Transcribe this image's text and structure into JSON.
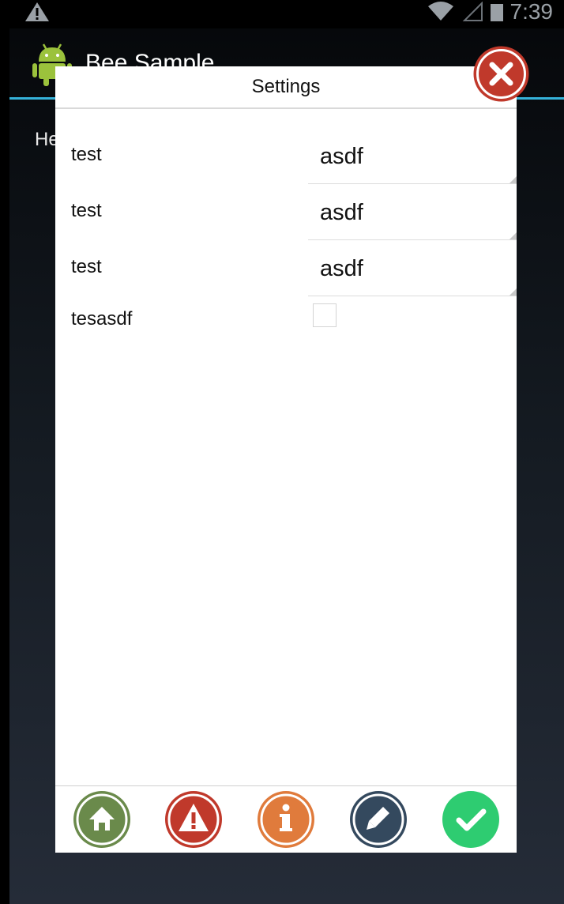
{
  "status_bar": {
    "time": "7:39",
    "icons": [
      "warning-icon",
      "wifi-icon",
      "signal-icon",
      "battery-icon"
    ]
  },
  "action_bar": {
    "title": "Bee Sample",
    "icon": "android-icon",
    "accent_color": "#35b2d9"
  },
  "background_text": "He",
  "dialog": {
    "title": "Settings",
    "rows": [
      {
        "label": "test",
        "value": "asdf",
        "type": "text"
      },
      {
        "label": "test",
        "value": "asdf",
        "type": "text"
      },
      {
        "label": "test",
        "value": "asdf",
        "type": "text"
      },
      {
        "label": "tesasdf",
        "checked": false,
        "type": "checkbox"
      }
    ],
    "close_icon": "close-icon",
    "close_color": "#c0392b",
    "footer_buttons": [
      {
        "icon": "home-icon",
        "color": "#6a8a4b"
      },
      {
        "icon": "warning-icon",
        "color": "#c0392b"
      },
      {
        "icon": "info-icon",
        "color": "#e07b3c"
      },
      {
        "icon": "edit-icon",
        "color": "#34495e"
      },
      {
        "icon": "check-icon",
        "color": "#2ecc71"
      }
    ]
  }
}
